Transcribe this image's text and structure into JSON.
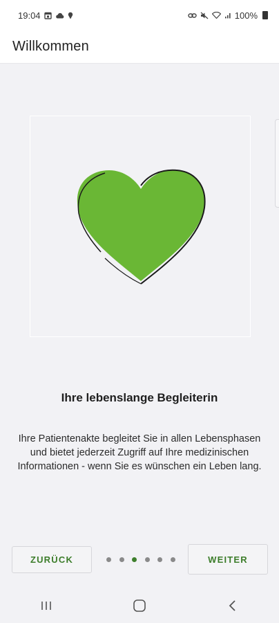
{
  "status_bar": {
    "time": "19:04",
    "battery_percent": "100%",
    "icons_left": [
      "calendar-icon",
      "cloud-icon",
      "location-pin-icon"
    ],
    "icons_right": [
      "link-icon",
      "mute-icon",
      "wifi-icon",
      "signal-icon",
      "battery-icon"
    ]
  },
  "app_bar": {
    "title": "Willkommen"
  },
  "onboarding": {
    "headline": "Ihre lebenslange Begleiterin",
    "body": "Ihre Patientenakte begleitet Sie in allen Lebensphasen und bietet jederzeit Zugriff auf Ihre medizinischen Informationen - wenn Sie es wünschen ein Leben lang.",
    "illustration": "heart-icon",
    "accent_color": "#6ab735",
    "page_count": 6,
    "current_page": 3
  },
  "buttons": {
    "back_label": "ZURÜCK",
    "next_label": "WEITER",
    "label_color": "#3c7d2a"
  },
  "nav_bar": {
    "items": [
      "recent-apps-icon",
      "home-icon",
      "back-icon"
    ]
  }
}
